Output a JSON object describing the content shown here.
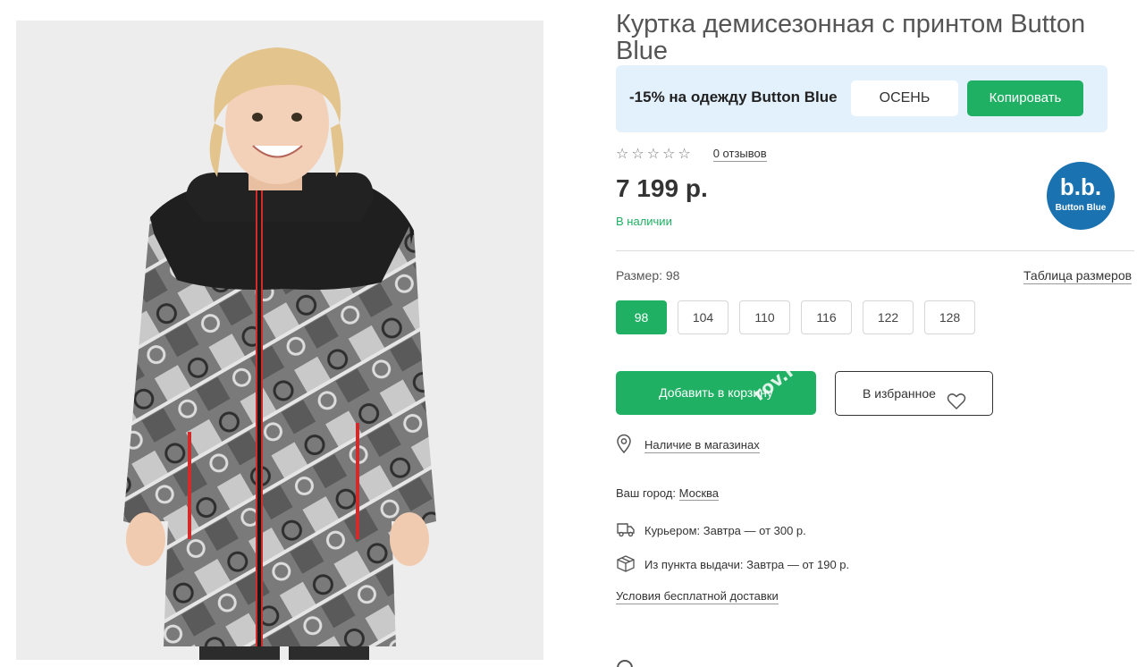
{
  "product": {
    "title": "Куртка демисезонная с принтом Button Blue",
    "price": "7 199 р.",
    "stock_status": "В наличии",
    "rating": {
      "stars_display": "☆☆☆☆☆",
      "reviews_label": "0 отзывов"
    }
  },
  "promo": {
    "text": "-15% на одежду Button Blue",
    "code": "ОСЕНЬ",
    "copy_label": "Копировать",
    "background_color": "#e3f1fd"
  },
  "brand": {
    "logo_letters": "b.b.",
    "logo_name": "Button Blue",
    "color": "#1a72b0"
  },
  "size_selector": {
    "label": "Размер: 98",
    "size_table_link": "Таблица размеров",
    "options": [
      "98",
      "104",
      "110",
      "116",
      "122",
      "128"
    ],
    "selected": "98"
  },
  "actions": {
    "add_to_cart": "Добавить в корзину",
    "favorite": "В избранное"
  },
  "watermark": "rov.ru",
  "availability": {
    "stores_link": "Наличие в магазинах"
  },
  "delivery": {
    "city_label": "Ваш город:",
    "city": "Москва",
    "courier": "Курьером: Завтра — от 300 р.",
    "pickup": "Из пункта выдачи: Завтра — от 190 р.",
    "free_delivery_link": "Условия бесплатной доставки"
  },
  "colors": {
    "accent_green": "#1fb063",
    "text_dark": "#333333"
  },
  "icons": {
    "rating": "star-outline-icon",
    "favorite": "heart-outline-icon",
    "stores": "map-pin-icon",
    "courier": "truck-icon",
    "pickup": "box-icon"
  }
}
